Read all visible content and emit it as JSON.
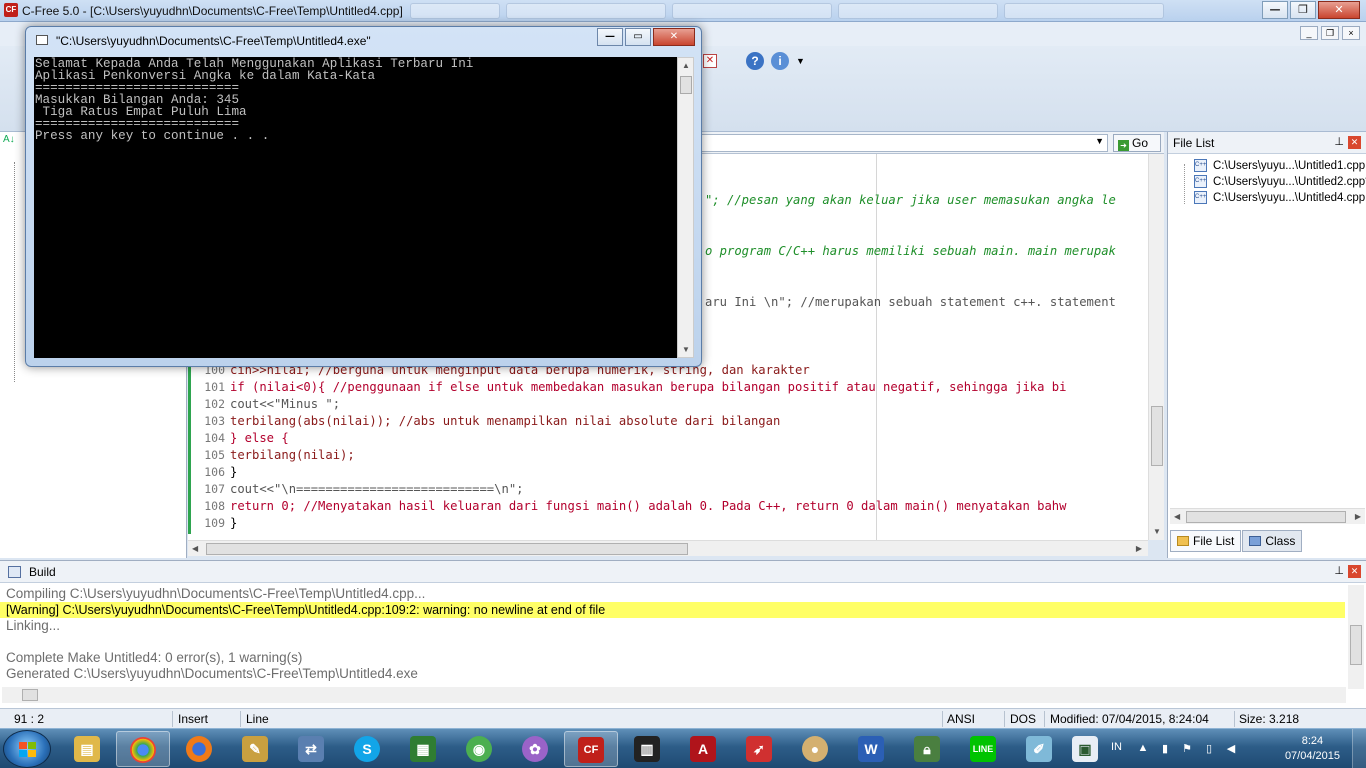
{
  "window": {
    "title": "C-Free 5.0 - [C:\\Users\\yuyudhn\\Documents\\C-Free\\Temp\\Untitled4.cpp]",
    "minimize": "—",
    "maximize": "❐",
    "close": "✕"
  },
  "editor": {
    "go_label": "Go",
    "partial_lines": [
      "\"; //pesan yang akan keluar jika user memasukan angka le",
      "o program C/C++ harus memiliki sebuah main. main merupak",
      "aru Ini \\n\"; //merupakan sebuah statement c++. statement"
    ],
    "lines": [
      {
        "num": "100",
        "code": "cin>>nilai; //berguna untuk menginput data berupa numerik, string, dan karakter"
      },
      {
        "num": "101",
        "code": "if (nilai<0){ //penggunaan if else untuk membedakan masukan berupa bilangan positif atau negatif, sehingga jika bi"
      },
      {
        "num": "102",
        "code": "cout<<\"Minus \";"
      },
      {
        "num": "103",
        "code": "terbilang(abs(nilai)); //abs untuk menampilkan nilai absolute dari bilangan"
      },
      {
        "num": "104",
        "code": "} else {"
      },
      {
        "num": "105",
        "code": "terbilang(nilai);"
      },
      {
        "num": "106",
        "code": "}"
      },
      {
        "num": "107",
        "code": "cout<<\"\\n===========================\\n\";"
      },
      {
        "num": "108",
        "code": "return 0; //Menyatakan hasil keluaran dari fungsi main() adalah 0. Pada C++, return 0 dalam main() menyatakan bahw"
      },
      {
        "num": "109",
        "code": "}"
      }
    ]
  },
  "file_list": {
    "title": "File List",
    "files": [
      "C:\\Users\\yuyu...\\Untitled1.cpp",
      "C:\\Users\\yuyu...\\Untitled2.cpp*",
      "C:\\Users\\yuyu...\\Untitled4.cpp"
    ],
    "tabs": [
      "File List",
      "Class"
    ]
  },
  "build": {
    "title": "Build",
    "lines": [
      "Compiling C:\\Users\\yuyudhn\\Documents\\C-Free\\Temp\\Untitled4.cpp...",
      "[Warning] C:\\Users\\yuyudhn\\Documents\\C-Free\\Temp\\Untitled4.cpp:109:2: warning: no newline at end of file",
      "Linking...",
      "",
      "Complete Make Untitled4: 0 error(s), 1 warning(s)",
      "Generated C:\\Users\\yuyudhn\\Documents\\C-Free\\Temp\\Untitled4.exe"
    ]
  },
  "status": {
    "position": "91 :  2",
    "mode": "Insert",
    "select": "Line",
    "encoding": "ANSI",
    "line_ending": "DOS",
    "modified": "Modified: 07/04/2015, 8:24:04",
    "size": "Size: 3.218"
  },
  "console": {
    "title": "\"C:\\Users\\yuyudhn\\Documents\\C-Free\\Temp\\Untitled4.exe\"",
    "lines": [
      "Selamat Kepada Anda Telah Menggunakan Aplikasi Terbaru Ini",
      "Aplikasi Penkonversi Angka ke dalam Kata-Kata",
      "===========================",
      "Masukkan Bilangan Anda: 345",
      " Tiga Ratus Empat Puluh Lima",
      "===========================",
      "Press any key to continue . . ."
    ]
  },
  "taskbar": {
    "apps": [
      "explorer-icon",
      "chrome-icon",
      "firefox-icon",
      "tool-icon",
      "network-icon",
      "skype-icon",
      "spreadsheet-icon",
      "globe-icon",
      "flower-icon",
      "cfree-icon",
      "reader-icon",
      "acrobat-icon",
      "bird-icon",
      "paint-icon",
      "word-icon",
      "security-icon",
      "line-icon",
      "note-icon",
      "window-icon"
    ],
    "language": "IN",
    "time": "8:24",
    "date": "07/04/2015"
  }
}
